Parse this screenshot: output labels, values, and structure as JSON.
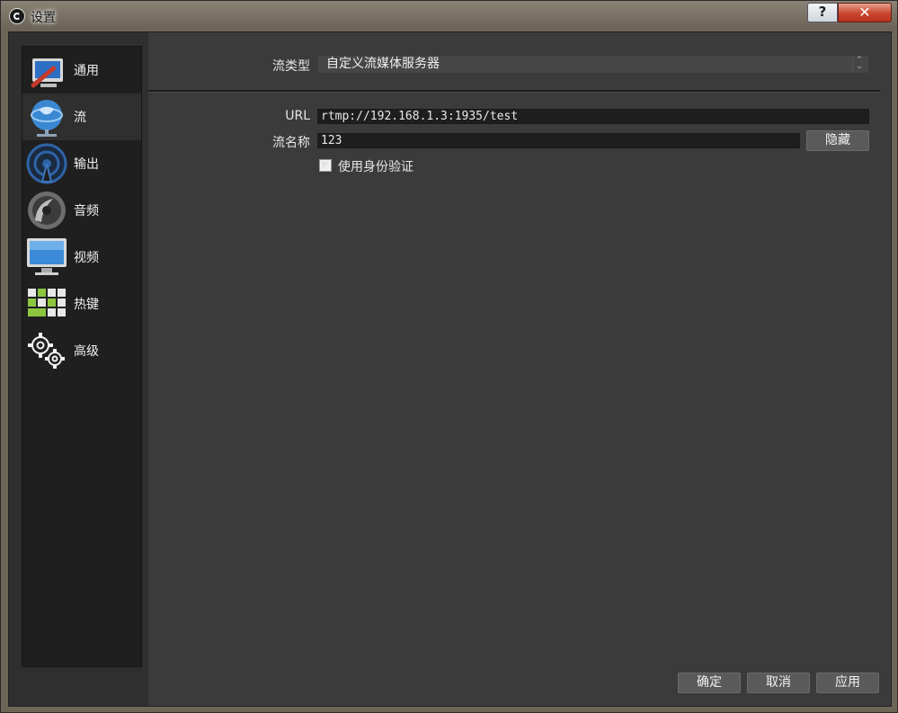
{
  "window": {
    "title": "设置",
    "help_glyph": "?",
    "close_glyph": "✕"
  },
  "sidebar": {
    "items": [
      {
        "label": "通用",
        "icon": "general-icon"
      },
      {
        "label": "流",
        "icon": "stream-globe-icon",
        "active": true
      },
      {
        "label": "输出",
        "icon": "output-antenna-icon"
      },
      {
        "label": "音频",
        "icon": "speaker-icon"
      },
      {
        "label": "视频",
        "icon": "monitor-icon"
      },
      {
        "label": "热键",
        "icon": "keyboard-icon"
      },
      {
        "label": "高级",
        "icon": "gears-icon"
      }
    ]
  },
  "stream": {
    "type_label": "流类型",
    "type_value": "自定义流媒体服务器",
    "url_label": "URL",
    "url_value": "rtmp://192.168.1.3:1935/test",
    "key_label": "流名称",
    "key_value": "123",
    "hide_button": "隐藏",
    "auth_label": "使用身份验证",
    "auth_checked": false
  },
  "footer": {
    "ok": "确定",
    "cancel": "取消",
    "apply": "应用"
  }
}
